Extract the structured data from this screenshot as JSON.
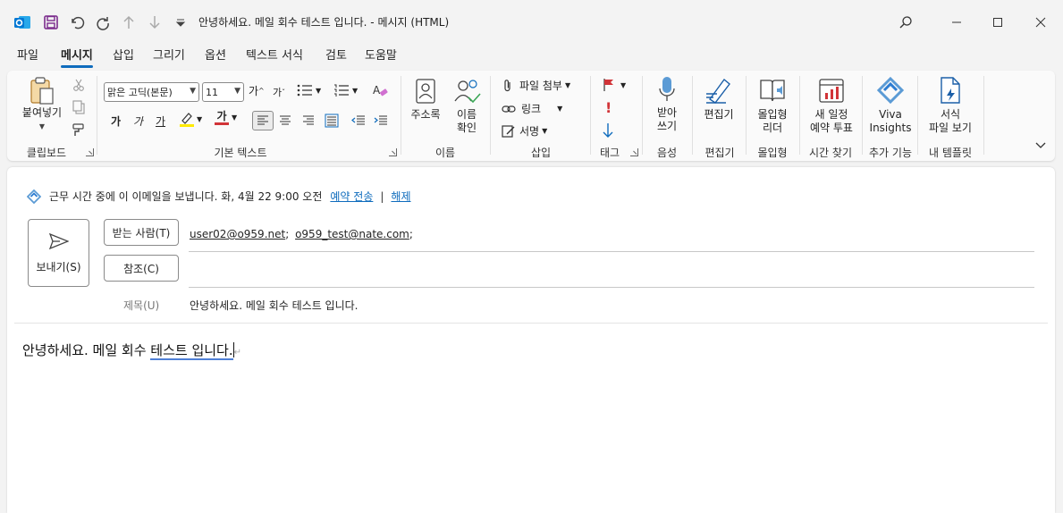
{
  "window": {
    "title": "안녕하세요. 메일 회수 테스트 입니다.  -  메시지 (HTML)"
  },
  "tabs": [
    {
      "label": "파일"
    },
    {
      "label": "메시지",
      "active": true
    },
    {
      "label": "삽입"
    },
    {
      "label": "그리기"
    },
    {
      "label": "옵션"
    },
    {
      "label": "텍스트 서식"
    },
    {
      "label": "검토"
    },
    {
      "label": "도움말"
    }
  ],
  "ribbon": {
    "clipboard": {
      "paste_label": "붙여넣기",
      "group": "클립보드"
    },
    "basic_text": {
      "font_name": "맑은 고딕(본문)",
      "font_size": "11",
      "grow": "가",
      "shrink": "가",
      "bold": "가",
      "italic": "가",
      "underline": "가",
      "font_color": "가",
      "group": "기본 텍스트"
    },
    "names": {
      "address_book": "주소록",
      "check_names_line1": "이름",
      "check_names_line2": "확인",
      "group": "이름"
    },
    "insert": {
      "attach_file": "파일 첨부",
      "link": "링크",
      "signature": "서명",
      "group": "삽입"
    },
    "tags": {
      "group": "태그"
    },
    "voice": {
      "dictate_line1": "받아",
      "dictate_line2": "쓰기",
      "group": "음성"
    },
    "editor": {
      "label": "편집기",
      "group": "편집기"
    },
    "immersive": {
      "line1": "몰입형",
      "line2": "리더",
      "group": "몰입형"
    },
    "find_time": {
      "line1": "새 일정",
      "line2": "예약 투표",
      "group": "시간 찾기"
    },
    "addins": {
      "line1": "Viva",
      "line2": "Insights",
      "group": "추가 기능"
    },
    "templates": {
      "line1": "서식",
      "line2": "파일 보기",
      "group": "내 템플릿"
    }
  },
  "compose": {
    "info": {
      "text": "근무 시간 중에 이 이메일을 보냅니다. 화, 4월 22 9:00 오전",
      "schedule_link": "예약 전송",
      "divider": "|",
      "cancel_link": "해제"
    },
    "send_label": "보내기(S)",
    "to_label": "받는 사람(T)",
    "cc_label": "참조(C)",
    "to_recipients": [
      "user02@o959.net",
      "o959_test@nate.com"
    ],
    "recipient_sep": ";",
    "cc_value": "",
    "subject_label": "제목(U)",
    "subject_value": "안녕하세요. 메일 회수 테스트 입니다.",
    "body_plain": "안녕하세요. 메일 회수 ",
    "body_underlined": "테스트 입니다.",
    "body_mark": "↵"
  },
  "colors": {
    "accent": "#0f6cbd",
    "outlook_blue": "#0078d4",
    "save_purple": "#7a2a8c",
    "highlight_yellow": "#ffeb00",
    "font_red": "#d13438"
  }
}
